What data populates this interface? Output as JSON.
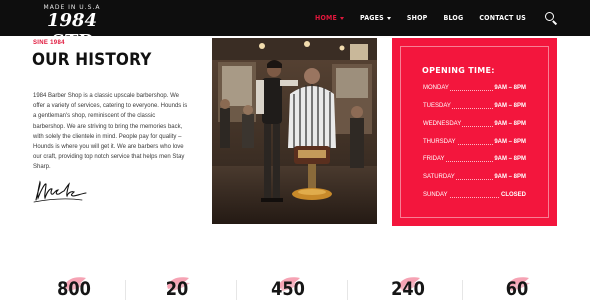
{
  "header": {
    "logo_top": "MADE IN U.S.A",
    "logo_main": "1984 STD",
    "nav": [
      {
        "label": "HOME",
        "active": true,
        "has_dropdown": true
      },
      {
        "label": "PAGES",
        "active": false,
        "has_dropdown": true
      },
      {
        "label": "SHOP",
        "active": false,
        "has_dropdown": false
      },
      {
        "label": "BLOG",
        "active": false,
        "has_dropdown": false
      },
      {
        "label": "CONTACT US",
        "active": false,
        "has_dropdown": false
      }
    ],
    "search_icon": "search-icon"
  },
  "history": {
    "kicker": "SINE 1984",
    "title": "OUR HISTORY",
    "body": "1984 Barber Shop is a classic upscale barbershop. We offer a variety of services, catering to everyone. Hounds is a gentleman's shop, reminiscent of the classic barbershop. We are striving to bring the memories back, with solely the clientele in mind. People pay for quality – Hounds is where you will get it. We are barbers who love our craft, providing top notch service that helps men Stay Sharp.",
    "signature": "Mack"
  },
  "photo": {
    "alt_icon": "barber-photo"
  },
  "hours": {
    "title": "OPENING TIME:",
    "rows": [
      {
        "day": "MONDAY",
        "time": "9AM – 8PM"
      },
      {
        "day": "TUESDAY",
        "time": "9AM – 8PM"
      },
      {
        "day": "WEDNESDAY",
        "time": "9AM – 8PM"
      },
      {
        "day": "THURSDAY",
        "time": "9AM – 8PM"
      },
      {
        "day": "FRIDAY",
        "time": "9AM – 8PM"
      },
      {
        "day": "SATURDAY",
        "time": "9AM – 8PM"
      },
      {
        "day": "SUNDAY",
        "time": "CLOSED"
      }
    ]
  },
  "stats": [
    {
      "value": "800"
    },
    {
      "value": "20"
    },
    {
      "value": "450"
    },
    {
      "value": "240"
    },
    {
      "value": "60"
    }
  ],
  "colors": {
    "accent": "#e0173c",
    "hours_bg": "#f3163d",
    "header_bg": "#0e0e0e"
  }
}
